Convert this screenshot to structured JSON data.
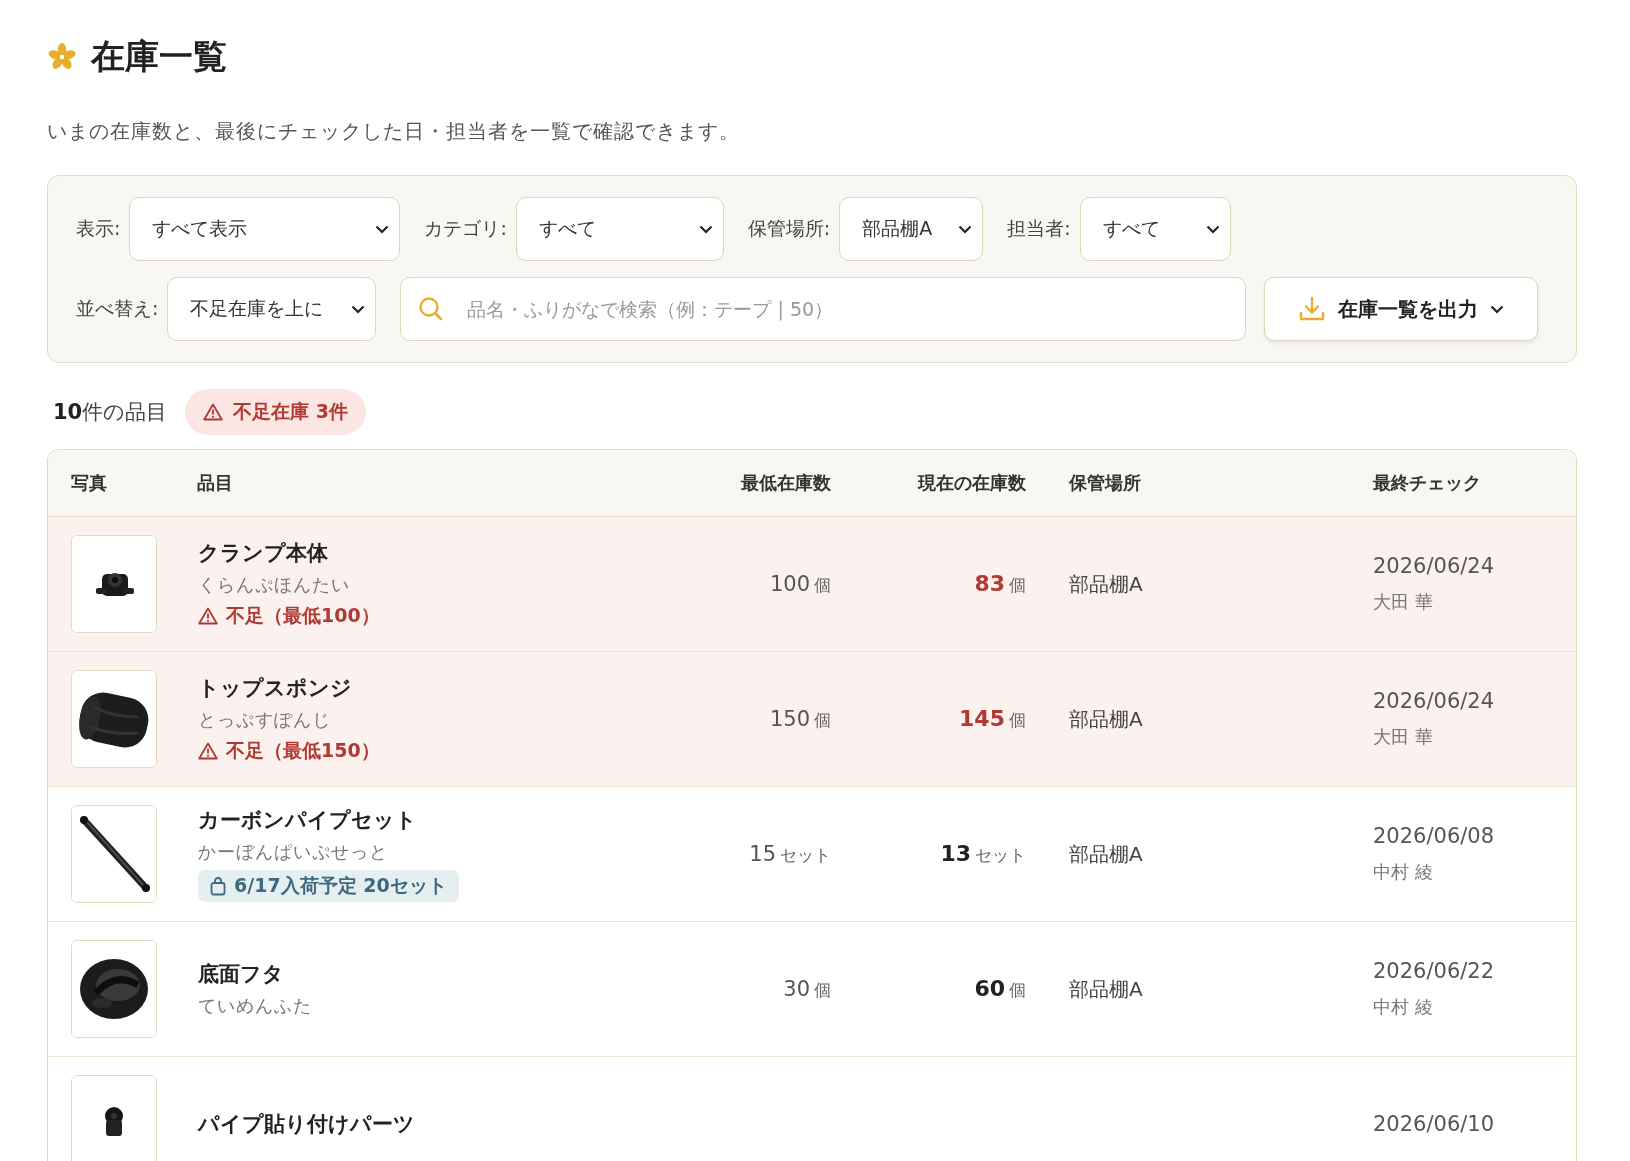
{
  "page": {
    "title": "在庫一覧",
    "subtitle": "いまの在庫数と、最後にチェックした日・担当者を一覧で確認できます。"
  },
  "filters": [
    {
      "label": "表示:",
      "value": "すべて表示"
    },
    {
      "label": "カテゴリ:",
      "value": "すべて"
    },
    {
      "label": "保管場所:",
      "value": "部品棚A"
    },
    {
      "label": "担当者:",
      "value": "すべて"
    }
  ],
  "sort": {
    "label": "並べ替え:",
    "value": "不足在庫を上に"
  },
  "search": {
    "placeholder": "品名・ふりがなで検索（例：テープ | 50）"
  },
  "export_button": {
    "label": "在庫一覧を出力"
  },
  "summary": {
    "count": "**10**件の品目",
    "shortage_badge": "不足在庫 3件"
  },
  "table": {
    "columns": [
      "写真",
      "品目",
      "最低在庫数",
      "現在の在庫数",
      "保管場所",
      "最終チェック"
    ],
    "rows": [
      {
        "name": "クランプ本体",
        "reading": "くらんぷほんたい",
        "status": {
          "kind": "shortage",
          "text": "不足（最低100）"
        },
        "min_qty": "100",
        "min_unit": "個",
        "current_qty": "83",
        "current_unit": "個",
        "low": true,
        "location": "部品棚A",
        "checked_date": "2026/06/24",
        "checked_by": "大田 華"
      },
      {
        "name": "トップスポンジ",
        "reading": "とっぷすぽんじ",
        "status": {
          "kind": "shortage",
          "text": "不足（最低150）"
        },
        "min_qty": "150",
        "min_unit": "個",
        "current_qty": "145",
        "current_unit": "個",
        "low": true,
        "location": "部品棚A",
        "checked_date": "2026/06/24",
        "checked_by": "大田 華"
      },
      {
        "name": "カーボンパイプセット",
        "reading": "かーぼんぱいぷせっと",
        "status": {
          "kind": "incoming",
          "text": "6/17入荷予定 20セット"
        },
        "min_qty": "15",
        "min_unit": "セット",
        "current_qty": "13",
        "current_unit": "セット",
        "low": false,
        "location": "部品棚A",
        "checked_date": "2026/06/08",
        "checked_by": "中村 綾"
      },
      {
        "name": "底面フタ",
        "reading": "ていめんふた",
        "min_qty": "30",
        "min_unit": "個",
        "current_qty": "60",
        "current_unit": "個",
        "low": false,
        "location": "部品棚A",
        "checked_date": "2026/06/22",
        "checked_by": "中村 綾"
      },
      {
        "name": "パイプ貼り付けパーツ",
        "low": false,
        "checked_date": "2026/06/10"
      }
    ]
  }
}
